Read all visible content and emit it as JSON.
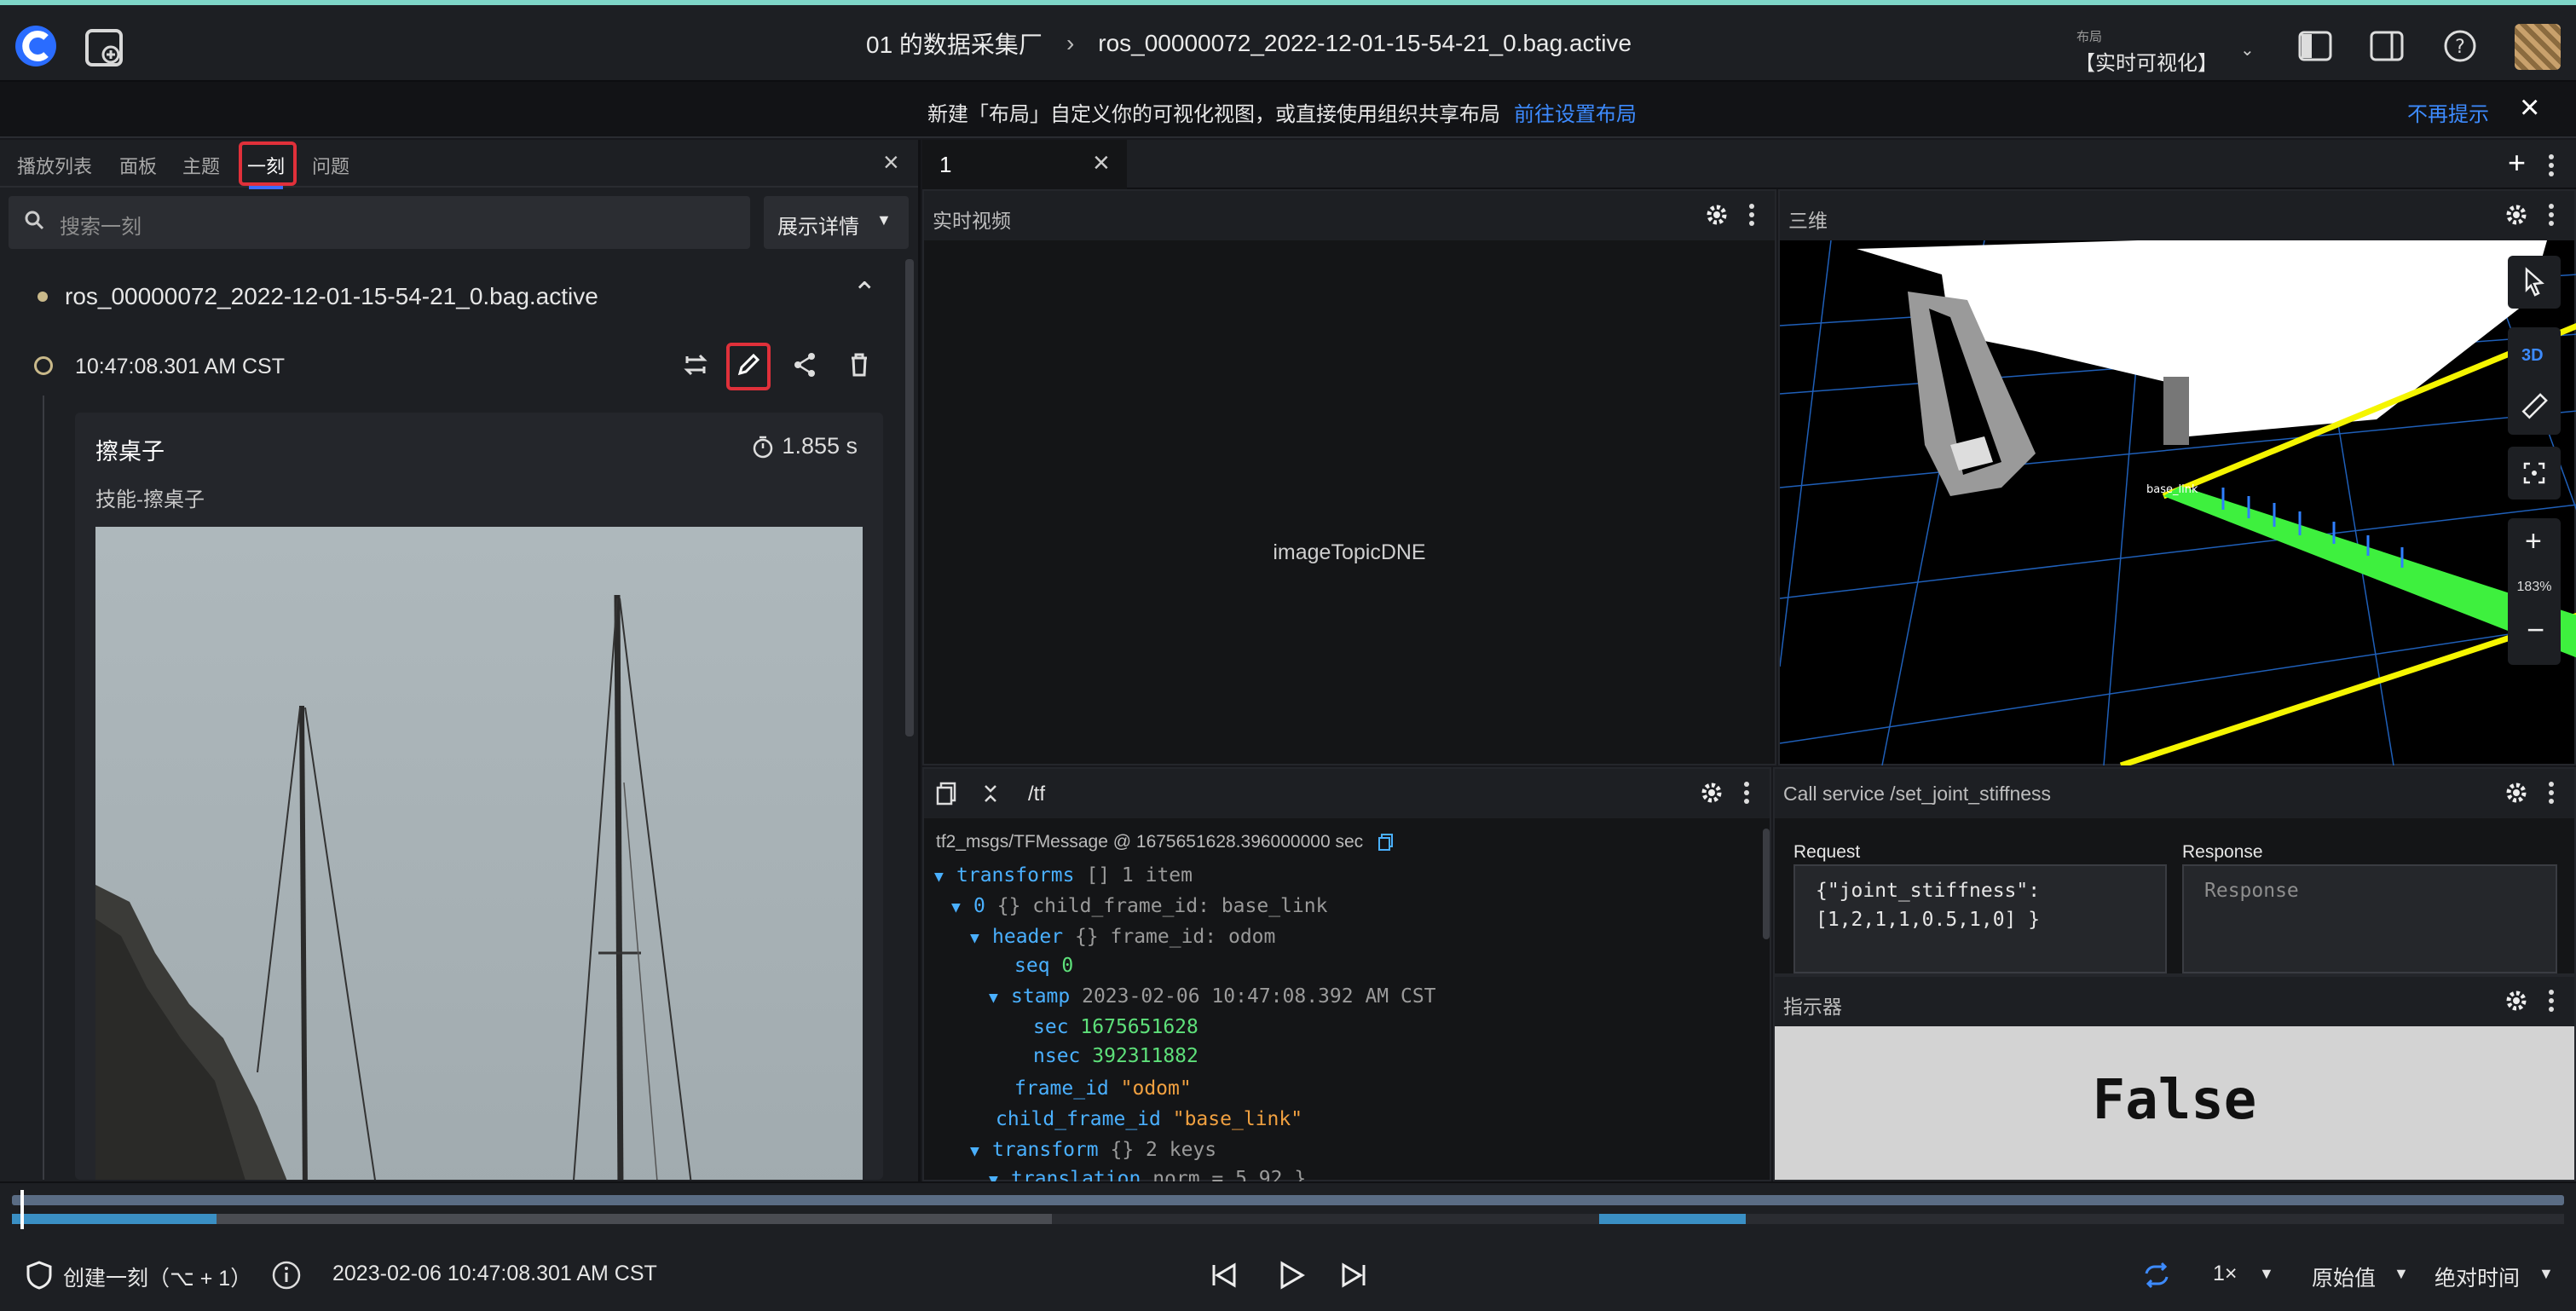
{
  "topbar": {
    "breadcrumb": [
      "01 的数据采集厂",
      "ros_00000072_2022-12-01-15-54-21_0.bag.active"
    ],
    "layout_caption": "布局",
    "layout_name": "【实时可视化】"
  },
  "notice": {
    "message": "新建「布局」自定义你的可视化视图，或直接使用组织共享布局",
    "link": "前往设置布局",
    "dismiss": "不再提示"
  },
  "sidebar": {
    "tabs": [
      "播放列表",
      "面板",
      "主题",
      "一刻",
      "问题"
    ],
    "active_tab": "一刻",
    "search_placeholder": "搜索一刻",
    "detail_button": "展示详情",
    "bag_name": "ros_00000072_2022-12-01-15-54-21_0.bag.active",
    "moment_time": "10:47:08.301 AM CST",
    "moment_title": "擦桌子",
    "moment_duration": "1.855 s",
    "moment_subtitle": "技能-擦桌子"
  },
  "layout_tab": {
    "label": "1"
  },
  "video_panel": {
    "title": "实时视频",
    "message": "imageTopicDNE"
  },
  "three_d_panel": {
    "title": "三维",
    "mode": "3D",
    "zoom": "183%",
    "frame_label": "base_link"
  },
  "tf_panel": {
    "topic": "/tf",
    "meta": "tf2_msgs/TFMessage @ 1675651628.396000000 sec",
    "tree": {
      "transforms_key": "transforms",
      "transforms_type": "[]",
      "transforms_count": "1 item",
      "idx": "0",
      "idx_summary": "{} child_frame_id: base_link",
      "header_key": "header",
      "header_summary": "{} frame_id: odom",
      "seq_key": "seq",
      "seq_val": "0",
      "stamp_key": "stamp",
      "stamp_val": "2023-02-06 10:47:08.392 AM CST",
      "sec_key": "sec",
      "sec_val": "1675651628",
      "nsec_key": "nsec",
      "nsec_val": "392311882",
      "frame_id_key": "frame_id",
      "frame_id_val": "\"odom\"",
      "child_key": "child_frame_id",
      "child_val": "\"base_link\"",
      "transform_key": "transform",
      "transform_summary": "{} 2 keys",
      "translation_key": "translation",
      "translation_summary": "norm = 5.92 }"
    }
  },
  "service_panel": {
    "title": "Call service /set_joint_stiffness",
    "request_label": "Request",
    "request_line1": "{\"joint_stiffness\":",
    "request_line2": "[1,2,1,1,0.5,1,0] }",
    "response_label": "Response",
    "response_placeholder": "Response"
  },
  "indicator_panel": {
    "title": "指示器",
    "value": "False"
  },
  "playback": {
    "create_moment": "创建一刻（⌥ + 1）",
    "current_time": "2023-02-06 10:47:08.301 AM CST",
    "speed": "1×",
    "value_mode": "原始值",
    "time_mode": "绝对时间"
  },
  "colors": {
    "accent": "#3d6bff",
    "highlight": "#e0303a",
    "link": "#3d8bff"
  }
}
